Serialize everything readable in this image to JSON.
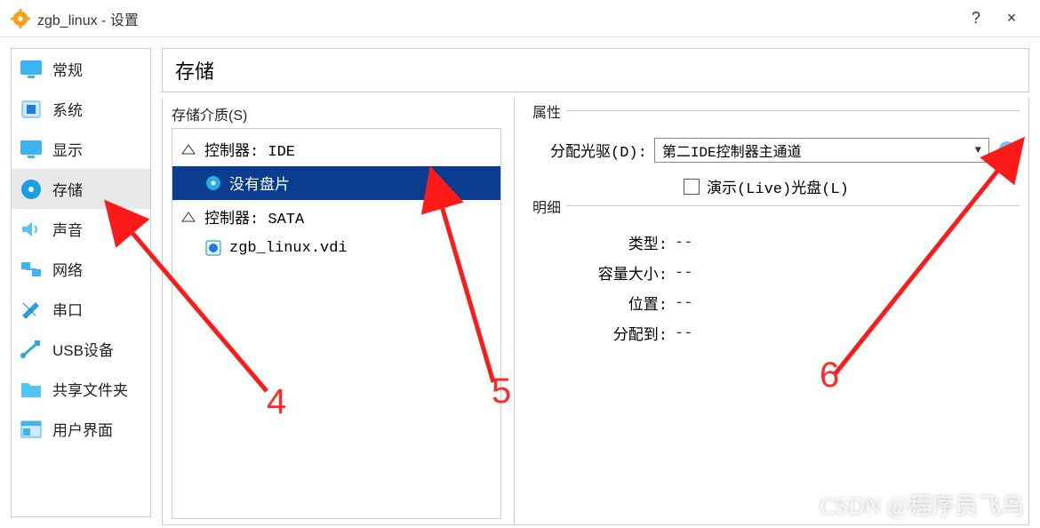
{
  "window": {
    "title": "zgb_linux - 设置",
    "help_symbol": "?",
    "close_symbol": "×"
  },
  "sidebar": {
    "items": [
      {
        "label": "常规",
        "icon": "monitor-icon"
      },
      {
        "label": "系统",
        "icon": "chip-icon"
      },
      {
        "label": "显示",
        "icon": "monitor-icon"
      },
      {
        "label": "存储",
        "icon": "disk-icon",
        "selected": true
      },
      {
        "label": "声音",
        "icon": "speaker-icon"
      },
      {
        "label": "网络",
        "icon": "network-icon"
      },
      {
        "label": "串口",
        "icon": "serial-icon"
      },
      {
        "label": "USB设备",
        "icon": "usb-icon"
      },
      {
        "label": "共享文件夹",
        "icon": "folder-icon"
      },
      {
        "label": "用户界面",
        "icon": "ui-icon"
      }
    ]
  },
  "main": {
    "header": "存储",
    "storage_media_label": "存储介质(S)",
    "tree": [
      {
        "label": "控制器: IDE",
        "icon": "controller-icon",
        "type": "controller"
      },
      {
        "label": "没有盘片",
        "icon": "optical-icon",
        "type": "child",
        "selected": true
      },
      {
        "label": "控制器: SATA",
        "icon": "controller-icon",
        "type": "controller"
      },
      {
        "label": "zgb_linux.vdi",
        "icon": "hdd-icon",
        "type": "child"
      }
    ],
    "attributes": {
      "section_label": "属性",
      "drive_label": "分配光驱(D):",
      "drive_value": "第二IDE控制器主通道",
      "live_cd_label": "演示(Live)光盘(L)"
    },
    "details": {
      "section_label": "明细",
      "rows": [
        {
          "label": "类型:",
          "value": "--"
        },
        {
          "label": "容量大小:",
          "value": "--"
        },
        {
          "label": "位置:",
          "value": "--"
        },
        {
          "label": "分配到:",
          "value": "--"
        }
      ]
    }
  },
  "annotations": {
    "n4": "4",
    "n5": "5",
    "n6": "6"
  },
  "watermark": "CSDN @程序员飞鸟"
}
